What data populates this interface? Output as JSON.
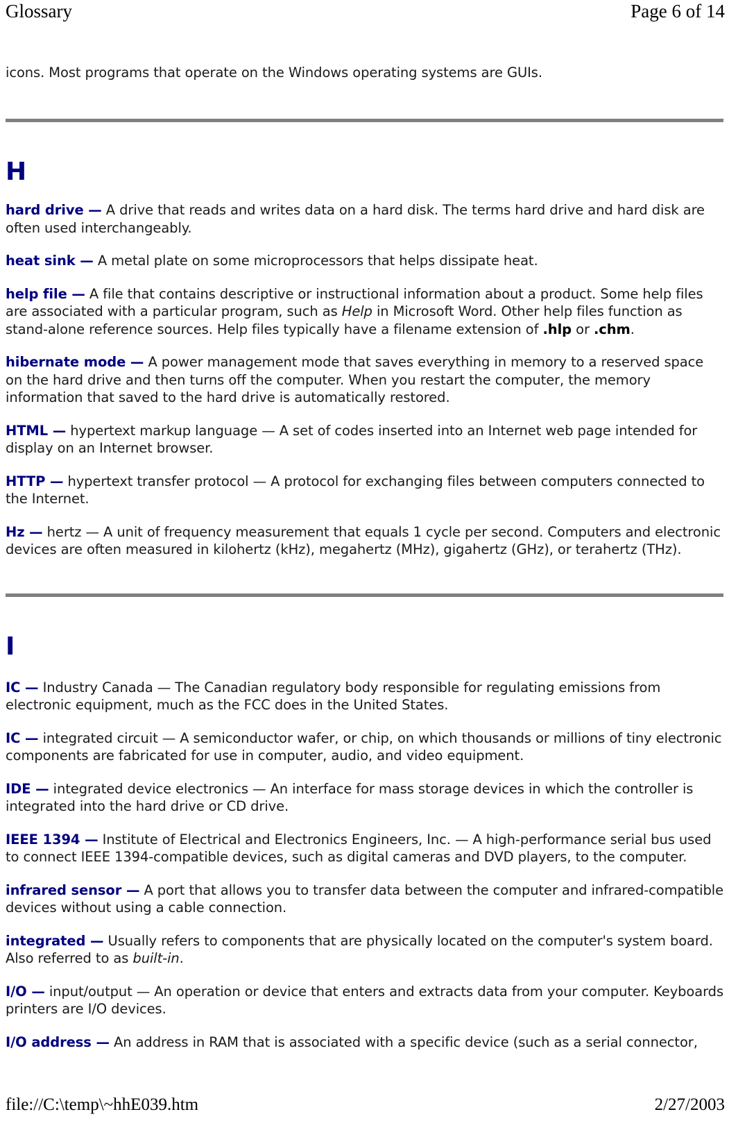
{
  "header": {
    "left_title": "Glossary",
    "right_pagination": "Page 6 of 14"
  },
  "footer": {
    "file_path": "file://C:\\temp\\~hhE039.htm",
    "date": "2/27/2003"
  },
  "colors": {
    "term_navy": "#000080",
    "heading_navy": "#000080",
    "rule_gray": "#808080",
    "body_black": "#1a1a1a",
    "background": "#ffffff"
  },
  "continued_paragraph": {
    "text": "icons. Most programs that operate on the Windows operating systems are GUIs."
  },
  "sections": [
    {
      "letter": "H",
      "entries": [
        {
          "term": "hard drive —",
          "parts": [
            {
              "style": "normal",
              "text": " A drive that reads and writes data on a hard disk. The terms hard drive and hard disk are often used interchangeably."
            }
          ]
        },
        {
          "term": "heat sink —",
          "parts": [
            {
              "style": "normal",
              "text": " A metal plate on some microprocessors that helps dissipate heat."
            }
          ]
        },
        {
          "term": "help file —",
          "parts": [
            {
              "style": "normal",
              "text": " A file that contains descriptive or instructional information about a product. Some help files are associated with a particular program, such as "
            },
            {
              "style": "italic",
              "text": "Help"
            },
            {
              "style": "normal",
              "text": " in Microsoft Word. Other help files function as stand-alone reference sources. Help files typically have a filename extension of "
            },
            {
              "style": "bold",
              "text": ".hlp"
            },
            {
              "style": "normal",
              "text": " or "
            },
            {
              "style": "bold",
              "text": ".chm"
            },
            {
              "style": "normal",
              "text": "."
            }
          ]
        },
        {
          "term": "hibernate mode —",
          "parts": [
            {
              "style": "normal",
              "text": " A power management mode that saves everything in memory to a reserved space on the hard drive and then turns off the computer. When you restart the computer, the memory information that saved to the hard drive is automatically restored."
            }
          ]
        },
        {
          "term": "HTML —",
          "parts": [
            {
              "style": "normal",
              "text": " hypertext markup language — A set of codes inserted into an Internet web page intended for display on an Internet browser."
            }
          ]
        },
        {
          "term": "HTTP —",
          "parts": [
            {
              "style": "normal",
              "text": " hypertext transfer protocol — A protocol for exchanging files between computers connected to the Internet."
            }
          ]
        },
        {
          "term": "Hz —",
          "parts": [
            {
              "style": "normal",
              "text": " hertz — A unit of frequency measurement that equals 1 cycle per second. Computers and electronic devices are often measured in kilohertz (kHz), megahertz (MHz), gigahertz (GHz), or terahertz (THz)."
            }
          ]
        }
      ]
    },
    {
      "letter": "I",
      "entries": [
        {
          "term": "IC —",
          "parts": [
            {
              "style": "normal",
              "text": " Industry Canada — The Canadian regulatory body responsible for regulating emissions from electronic equipment, much as the FCC does in the United States."
            }
          ]
        },
        {
          "term": "IC —",
          "parts": [
            {
              "style": "normal",
              "text": " integrated circuit — A semiconductor wafer, or chip, on which thousands or millions of tiny electronic components are fabricated for use in computer, audio, and video equipment."
            }
          ]
        },
        {
          "term": "IDE —",
          "parts": [
            {
              "style": "normal",
              "text": " integrated device electronics — An interface for mass storage devices in which the controller is integrated into the hard drive or CD drive."
            }
          ]
        },
        {
          "term": "IEEE 1394 —",
          "parts": [
            {
              "style": "normal",
              "text": " Institute of Electrical and Electronics Engineers, Inc. — A high-performance serial bus used to connect IEEE 1394-compatible devices, such as digital cameras and DVD players, to the computer."
            }
          ]
        },
        {
          "term": "infrared sensor —",
          "parts": [
            {
              "style": "normal",
              "text": " A port that allows you to transfer data between the computer and infrared-compatible devices without using a cable connection."
            }
          ]
        },
        {
          "term": "integrated —",
          "parts": [
            {
              "style": "normal",
              "text": " Usually refers to components that are physically located on the computer's system board. Also referred to as "
            },
            {
              "style": "italic",
              "text": "built-in"
            },
            {
              "style": "normal",
              "text": "."
            }
          ]
        },
        {
          "term": "I/O —",
          "parts": [
            {
              "style": "normal",
              "text": " input/output — An operation or device that enters and extracts data from your computer. Keyboards printers are I/O devices."
            }
          ]
        },
        {
          "term": "I/O address —",
          "parts": [
            {
              "style": "normal",
              "text": " An address in RAM that is associated with a specific device (such as a serial connector,"
            }
          ]
        }
      ]
    }
  ]
}
